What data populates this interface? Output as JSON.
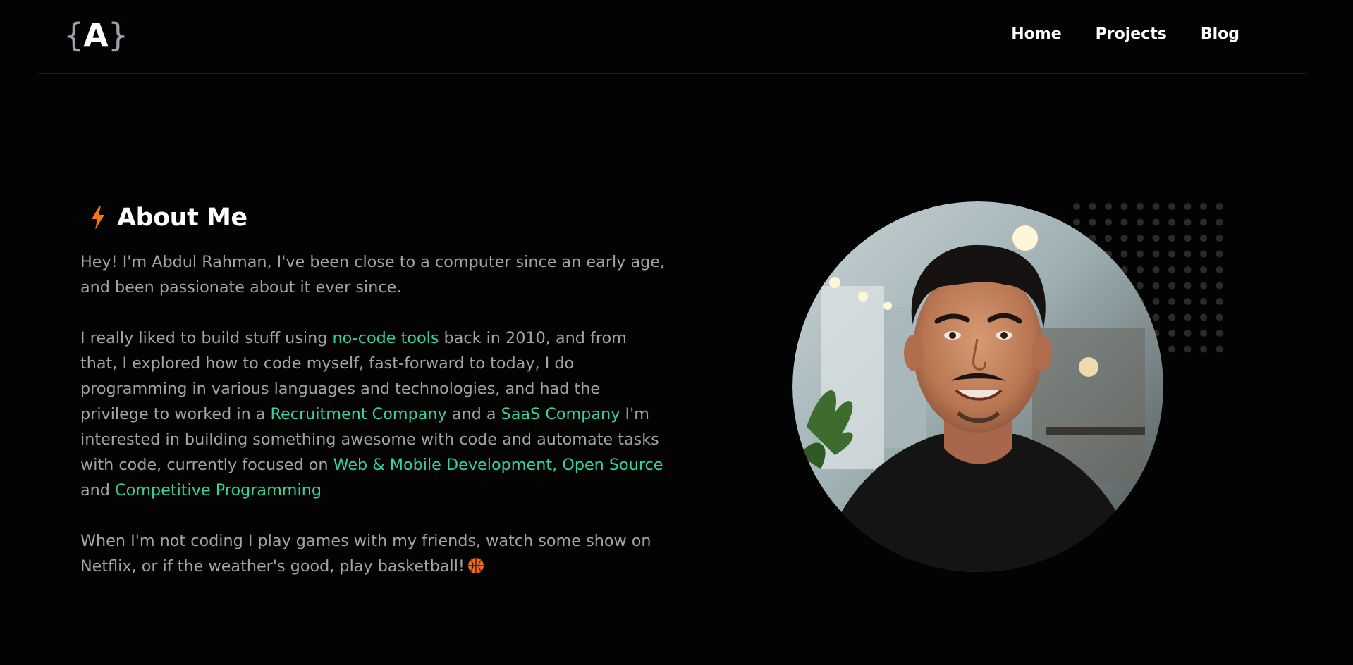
{
  "header": {
    "logo": {
      "brace_open": "{",
      "letter": "A",
      "brace_close": "}"
    },
    "nav": [
      {
        "label": "Home"
      },
      {
        "label": "Projects"
      },
      {
        "label": "Blog"
      }
    ]
  },
  "about": {
    "title": "About Me",
    "title_icon": "lightning-bolt-icon",
    "paragraph1": "Hey! I'm Abdul Rahman, I've been close to a computer since an early age, and been passionate about it ever since.",
    "paragraph2": {
      "t1": "I really liked to build stuff using ",
      "h1": "no-code tools",
      "t2": " back in 2010, and from that, I explored how to code myself, fast-forward to today, I do programming in various languages and technologies, and had the privilege to worked in a ",
      "h2": "Recruitment Company",
      "t3": " and a ",
      "h3": "SaaS Company",
      "t4": " I'm interested in building something awesome with code and automate tasks with code, currently focused on ",
      "h4": "Web & Mobile Development,",
      "t5": " ",
      "h5": "Open Source",
      "t6": " and ",
      "h6": "Competitive Programming"
    },
    "paragraph3": "When I'm not coding I play games with my friends, watch some show on Netflix, or if the weather's good, play basketball!",
    "paragraph3_icon": "basketball-icon"
  },
  "colors": {
    "background": "#030303",
    "text": "#a3a3a3",
    "heading": "#ffffff",
    "highlight": "#34d399",
    "accent": "#f97316"
  }
}
